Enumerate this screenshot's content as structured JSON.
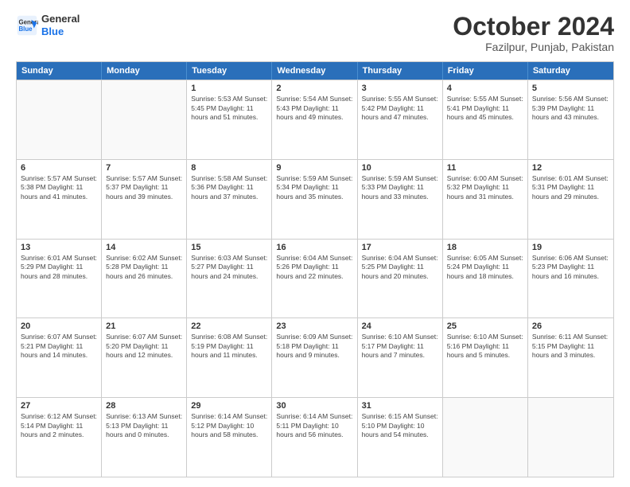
{
  "header": {
    "logo_line1": "General",
    "logo_line2": "Blue",
    "title": "October 2024",
    "subtitle": "Fazilpur, Punjab, Pakistan"
  },
  "calendar": {
    "days_of_week": [
      "Sunday",
      "Monday",
      "Tuesday",
      "Wednesday",
      "Thursday",
      "Friday",
      "Saturday"
    ],
    "weeks": [
      [
        {
          "day": "",
          "info": ""
        },
        {
          "day": "",
          "info": ""
        },
        {
          "day": "1",
          "info": "Sunrise: 5:53 AM\nSunset: 5:45 PM\nDaylight: 11 hours and 51 minutes."
        },
        {
          "day": "2",
          "info": "Sunrise: 5:54 AM\nSunset: 5:43 PM\nDaylight: 11 hours and 49 minutes."
        },
        {
          "day": "3",
          "info": "Sunrise: 5:55 AM\nSunset: 5:42 PM\nDaylight: 11 hours and 47 minutes."
        },
        {
          "day": "4",
          "info": "Sunrise: 5:55 AM\nSunset: 5:41 PM\nDaylight: 11 hours and 45 minutes."
        },
        {
          "day": "5",
          "info": "Sunrise: 5:56 AM\nSunset: 5:39 PM\nDaylight: 11 hours and 43 minutes."
        }
      ],
      [
        {
          "day": "6",
          "info": "Sunrise: 5:57 AM\nSunset: 5:38 PM\nDaylight: 11 hours and 41 minutes."
        },
        {
          "day": "7",
          "info": "Sunrise: 5:57 AM\nSunset: 5:37 PM\nDaylight: 11 hours and 39 minutes."
        },
        {
          "day": "8",
          "info": "Sunrise: 5:58 AM\nSunset: 5:36 PM\nDaylight: 11 hours and 37 minutes."
        },
        {
          "day": "9",
          "info": "Sunrise: 5:59 AM\nSunset: 5:34 PM\nDaylight: 11 hours and 35 minutes."
        },
        {
          "day": "10",
          "info": "Sunrise: 5:59 AM\nSunset: 5:33 PM\nDaylight: 11 hours and 33 minutes."
        },
        {
          "day": "11",
          "info": "Sunrise: 6:00 AM\nSunset: 5:32 PM\nDaylight: 11 hours and 31 minutes."
        },
        {
          "day": "12",
          "info": "Sunrise: 6:01 AM\nSunset: 5:31 PM\nDaylight: 11 hours and 29 minutes."
        }
      ],
      [
        {
          "day": "13",
          "info": "Sunrise: 6:01 AM\nSunset: 5:29 PM\nDaylight: 11 hours and 28 minutes."
        },
        {
          "day": "14",
          "info": "Sunrise: 6:02 AM\nSunset: 5:28 PM\nDaylight: 11 hours and 26 minutes."
        },
        {
          "day": "15",
          "info": "Sunrise: 6:03 AM\nSunset: 5:27 PM\nDaylight: 11 hours and 24 minutes."
        },
        {
          "day": "16",
          "info": "Sunrise: 6:04 AM\nSunset: 5:26 PM\nDaylight: 11 hours and 22 minutes."
        },
        {
          "day": "17",
          "info": "Sunrise: 6:04 AM\nSunset: 5:25 PM\nDaylight: 11 hours and 20 minutes."
        },
        {
          "day": "18",
          "info": "Sunrise: 6:05 AM\nSunset: 5:24 PM\nDaylight: 11 hours and 18 minutes."
        },
        {
          "day": "19",
          "info": "Sunrise: 6:06 AM\nSunset: 5:23 PM\nDaylight: 11 hours and 16 minutes."
        }
      ],
      [
        {
          "day": "20",
          "info": "Sunrise: 6:07 AM\nSunset: 5:21 PM\nDaylight: 11 hours and 14 minutes."
        },
        {
          "day": "21",
          "info": "Sunrise: 6:07 AM\nSunset: 5:20 PM\nDaylight: 11 hours and 12 minutes."
        },
        {
          "day": "22",
          "info": "Sunrise: 6:08 AM\nSunset: 5:19 PM\nDaylight: 11 hours and 11 minutes."
        },
        {
          "day": "23",
          "info": "Sunrise: 6:09 AM\nSunset: 5:18 PM\nDaylight: 11 hours and 9 minutes."
        },
        {
          "day": "24",
          "info": "Sunrise: 6:10 AM\nSunset: 5:17 PM\nDaylight: 11 hours and 7 minutes."
        },
        {
          "day": "25",
          "info": "Sunrise: 6:10 AM\nSunset: 5:16 PM\nDaylight: 11 hours and 5 minutes."
        },
        {
          "day": "26",
          "info": "Sunrise: 6:11 AM\nSunset: 5:15 PM\nDaylight: 11 hours and 3 minutes."
        }
      ],
      [
        {
          "day": "27",
          "info": "Sunrise: 6:12 AM\nSunset: 5:14 PM\nDaylight: 11 hours and 2 minutes."
        },
        {
          "day": "28",
          "info": "Sunrise: 6:13 AM\nSunset: 5:13 PM\nDaylight: 11 hours and 0 minutes."
        },
        {
          "day": "29",
          "info": "Sunrise: 6:14 AM\nSunset: 5:12 PM\nDaylight: 10 hours and 58 minutes."
        },
        {
          "day": "30",
          "info": "Sunrise: 6:14 AM\nSunset: 5:11 PM\nDaylight: 10 hours and 56 minutes."
        },
        {
          "day": "31",
          "info": "Sunrise: 6:15 AM\nSunset: 5:10 PM\nDaylight: 10 hours and 54 minutes."
        },
        {
          "day": "",
          "info": ""
        },
        {
          "day": "",
          "info": ""
        }
      ]
    ]
  }
}
